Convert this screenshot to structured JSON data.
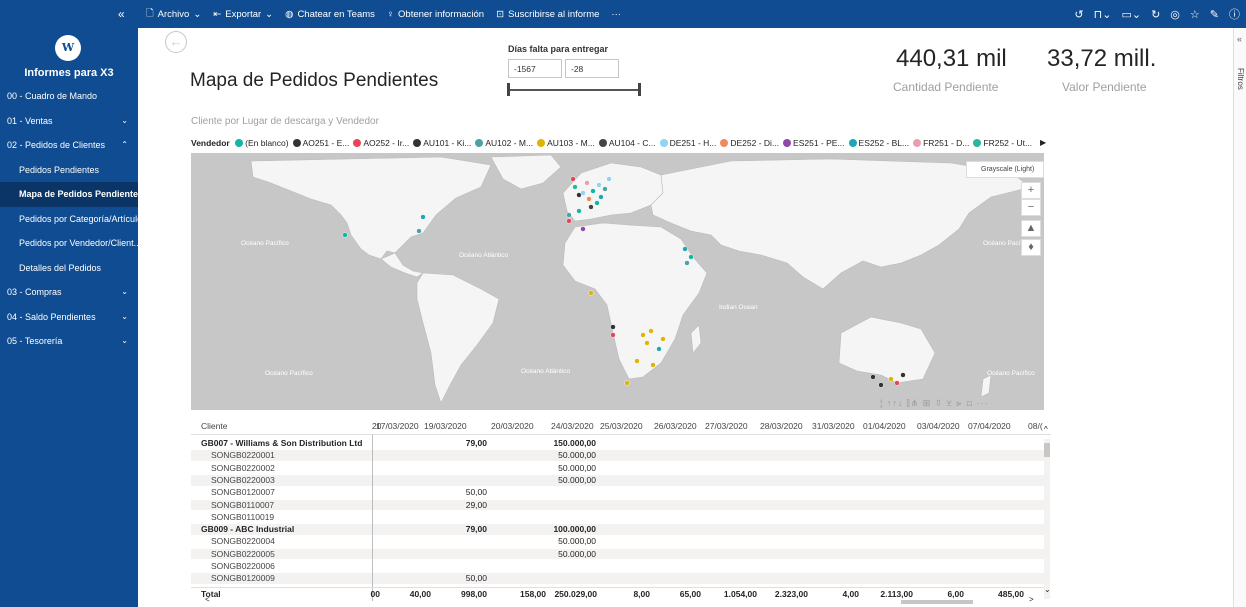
{
  "topbar": {
    "collapse": "«",
    "menu": [
      {
        "icon": "file-icon",
        "glyph": "🗋",
        "label": "Archivo",
        "caret": "⌄"
      },
      {
        "icon": "export-icon",
        "glyph": "⇤",
        "label": "Exportar",
        "caret": "⌄"
      },
      {
        "icon": "teams-icon",
        "glyph": "◍",
        "label": "Chatear en Teams",
        "caret": ""
      },
      {
        "icon": "lightbulb-icon",
        "glyph": "♀",
        "label": "Obtener información",
        "caret": ""
      },
      {
        "icon": "subscribe-icon",
        "glyph": "⊡",
        "label": "Suscribirse al informe",
        "caret": ""
      },
      {
        "icon": "more-icon",
        "glyph": "",
        "label": "···",
        "caret": ""
      }
    ],
    "right_icons": [
      {
        "name": "reset-icon",
        "glyph": "↺"
      },
      {
        "name": "bookmark-icon",
        "glyph": "⊓⌄"
      },
      {
        "name": "view-icon",
        "glyph": "▭⌄"
      },
      {
        "name": "refresh-icon",
        "glyph": "↻"
      },
      {
        "name": "comment-icon",
        "glyph": "◎"
      },
      {
        "name": "favorite-icon",
        "glyph": "☆"
      },
      {
        "name": "edit-icon",
        "glyph": "✎"
      },
      {
        "name": "info-icon",
        "glyph": "ⓘ"
      }
    ]
  },
  "sidebar": {
    "logo_text": "W",
    "title": "Informes para X3",
    "items": [
      {
        "label": "00 - Cuadro de Mando",
        "chevron": "",
        "level": 0,
        "active": false
      },
      {
        "label": "01 - Ventas",
        "chevron": "⌄",
        "level": 0,
        "active": false
      },
      {
        "label": "02 - Pedidos de Clientes",
        "chevron": "⌃",
        "level": 0,
        "active": false
      },
      {
        "label": "Pedidos Pendientes",
        "chevron": "",
        "level": 1,
        "active": false
      },
      {
        "label": "Mapa de Pedidos Pendientes",
        "chevron": "",
        "level": 1,
        "active": true
      },
      {
        "label": "Pedidos por Categoría/Artículo",
        "chevron": "",
        "level": 1,
        "active": false
      },
      {
        "label": "Pedidos por Vendedor/Client...",
        "chevron": "",
        "level": 1,
        "active": false
      },
      {
        "label": "Detalles del Pedidos",
        "chevron": "",
        "level": 1,
        "active": false
      },
      {
        "label": "03 - Compras",
        "chevron": "⌄",
        "level": 0,
        "active": false
      },
      {
        "label": "04 - Saldo Pendientes",
        "chevron": "⌄",
        "level": 0,
        "active": false
      },
      {
        "label": "05 - Tesorería",
        "chevron": "⌄",
        "level": 0,
        "active": false
      }
    ]
  },
  "filters_pane": {
    "label": "Filtros",
    "arrow": "«"
  },
  "page": {
    "title": "Mapa de Pedidos Pendientes",
    "back_glyph": "←"
  },
  "slicer": {
    "title": "Días falta para entregar",
    "min": "-1567",
    "max": "-28"
  },
  "kpis": [
    {
      "value": "440,31 mil",
      "label": "Cantidad Pendiente"
    },
    {
      "value": "33,72 mill.",
      "label": "Valor Pendiente"
    }
  ],
  "map": {
    "subtitle": "Cliente por Lugar de descarga y Vendedor",
    "legend_title": "Vendedor",
    "legend": [
      {
        "label": "(En blanco)",
        "color": "#12b5a6"
      },
      {
        "label": "AO251 - E...",
        "color": "#333333"
      },
      {
        "label": "AO252 - Ir...",
        "color": "#e8455a"
      },
      {
        "label": "AU101 - Ki...",
        "color": "#333333"
      },
      {
        "label": "AU102 - M...",
        "color": "#4aa3a0"
      },
      {
        "label": "AU103 - M...",
        "color": "#e0b400"
      },
      {
        "label": "AU104 - C...",
        "color": "#444444"
      },
      {
        "label": "DE251 - H...",
        "color": "#8fd4f0"
      },
      {
        "label": "DE252 - Di...",
        "color": "#f08a5d"
      },
      {
        "label": "ES251 - PE...",
        "color": "#8e4aa8"
      },
      {
        "label": "ES252 - BL...",
        "color": "#20a7b3"
      },
      {
        "label": "FR251 - D...",
        "color": "#e8a0b0"
      },
      {
        "label": "FR252 - Ut...",
        "color": "#2ab5a0"
      }
    ],
    "legend_next": "▶",
    "ocean_labels": [
      "Océano Pacífico",
      "Océano Atlántico",
      "Océano Pacífico",
      "Indian Ocean",
      "Océano Pacífico",
      "Océano Atlántico",
      "Océano Pacífico"
    ],
    "basemap_label": "Grayscale (Light)",
    "buttons": [
      "+",
      "−",
      "▲",
      "♦"
    ],
    "colors": {
      "water": "#c7c7c7",
      "land": "#f5f5f5"
    }
  },
  "table": {
    "icons": "¦ ↑↑↓ ⫿⋔ ⊞ ▯ ⊻ ⊳ ⊡ ···",
    "col_header": "Cliente",
    "dates": [
      "20",
      "17/03/2020",
      "19/03/2020",
      "20/03/2020",
      "24/03/2020",
      "25/03/2020",
      "26/03/2020",
      "27/03/2020",
      "28/03/2020",
      "31/03/2020",
      "01/04/2020",
      "03/04/2020",
      "07/04/2020",
      "08/("
    ],
    "rows": [
      {
        "name": "GB007 - Williams & Son Distribution Ltd",
        "type": "grp",
        "vals": {
          "c2": "79,00",
          "c4": "150.000,00"
        }
      },
      {
        "name": "SONGB0220001",
        "type": "sub",
        "vals": {
          "c4": "50.000,00"
        }
      },
      {
        "name": "SONGB0220002",
        "type": "sub",
        "vals": {
          "c4": "50.000,00"
        }
      },
      {
        "name": "SONGB0220003",
        "type": "sub",
        "vals": {
          "c4": "50.000,00"
        }
      },
      {
        "name": "SONGB0120007",
        "type": "sub",
        "vals": {
          "c2": "50,00"
        }
      },
      {
        "name": "SONGB0110007",
        "type": "sub",
        "vals": {
          "c2": "29,00"
        }
      },
      {
        "name": "SONGB0110019",
        "type": "sub",
        "vals": {}
      },
      {
        "name": "GB009 - ABC Industrial",
        "type": "grp",
        "vals": {
          "c2": "79,00",
          "c4": "100.000,00"
        }
      },
      {
        "name": "SONGB0220004",
        "type": "sub",
        "vals": {
          "c4": "50.000,00"
        }
      },
      {
        "name": "SONGB0220005",
        "type": "sub",
        "vals": {
          "c4": "50.000,00"
        }
      },
      {
        "name": "SONGB0220006",
        "type": "sub",
        "vals": {}
      },
      {
        "name": "SONGB0120009",
        "type": "sub",
        "vals": {
          "c2": "50,00"
        }
      }
    ],
    "total": {
      "label": "Total",
      "vals": [
        "00",
        "40,00",
        "998,00",
        "158,00",
        "250.029,00",
        "8,00",
        "65,00",
        "1.054,00",
        "2.323,00",
        "4,00",
        "2.113,00",
        "6,00",
        "485,00"
      ]
    },
    "scroll": {
      "left": "<",
      "right": ">",
      "down": "⌄",
      "up": "^"
    }
  }
}
